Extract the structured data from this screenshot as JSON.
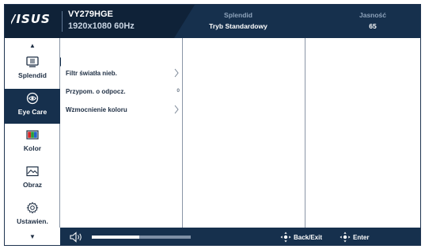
{
  "header": {
    "brand": "/ISUS",
    "model": "VY279HGE",
    "resolution": "1920x1080 60Hz",
    "splendid_label": "Splendid",
    "splendid_value": "Tryb Standardowy",
    "brightness_label": "Jasność",
    "brightness_value": "65"
  },
  "sidebar": {
    "up_arrow": "▲",
    "down_arrow": "▼",
    "active": "Eye Care",
    "items": [
      {
        "label": "Splendid",
        "icon": "splendid-icon"
      },
      {
        "label": "Eye Care",
        "icon": "eye-icon"
      },
      {
        "label": "Kolor",
        "icon": "color-bars-icon"
      },
      {
        "label": "Obraz",
        "icon": "image-wave-icon"
      },
      {
        "label": "Ustawien.",
        "icon": "gear-icon"
      }
    ]
  },
  "menu": {
    "items": [
      {
        "label": "Filtr światła nieb.",
        "indicator": "chevron-right-icon"
      },
      {
        "label": "Przypom. o odpocz.",
        "value": "0"
      },
      {
        "label": "Wzmocnienie koloru",
        "indicator": "chevron-right-icon"
      }
    ]
  },
  "bottom": {
    "volume_icon": "speaker-icon",
    "volume_level_percent": 48,
    "back_label": "Back/Exit",
    "enter_label": "Enter"
  },
  "colors": {
    "header_bg": "#16304d",
    "header_dark": "#0f2238",
    "accent_text": "#8ea3bb",
    "divider": "#8a96a6"
  }
}
